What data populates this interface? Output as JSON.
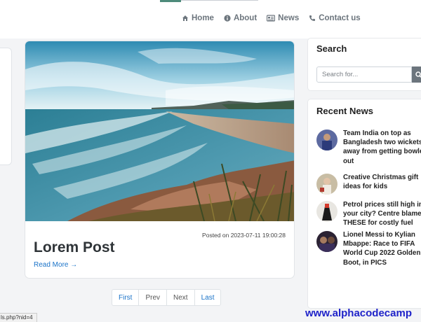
{
  "nav": {
    "items": [
      {
        "label": "Home",
        "icon": "home-icon"
      },
      {
        "label": "About",
        "icon": "info-icon"
      },
      {
        "label": "News",
        "icon": "newspaper-icon"
      },
      {
        "label": "Contact us",
        "icon": "phone-icon"
      }
    ]
  },
  "post": {
    "date": "Posted on 2023-07-11 19:00:28",
    "title": "Lorem Post",
    "read_more": "Read More →"
  },
  "pagination": [
    "First",
    "Prev",
    "Next",
    "Last"
  ],
  "search": {
    "title": "Search",
    "placeholder": "Search for..."
  },
  "recent_news": {
    "title": "Recent News",
    "items": [
      {
        "text": "Team India on top as\nBangladesh two wickets\naway from getting bowled\nout"
      },
      {
        "text": "Creative Christmas gift\nideas for kids"
      },
      {
        "text": "Petrol prices still high in\nyour city? Centre blames\nTHESE for costly fuel"
      },
      {
        "text": "Lionel Messi to Kylian\nMbappe: Race to FIFA\nWorld Cup 2022 Golden\nBoot, in PICS"
      }
    ]
  },
  "status_url": "ls.php?nid=4",
  "watermark": "www.alphacodecamp",
  "colors": {
    "link": "#1a73c8",
    "watermark": "#1f23c9",
    "accent": "#4e8b7b"
  }
}
